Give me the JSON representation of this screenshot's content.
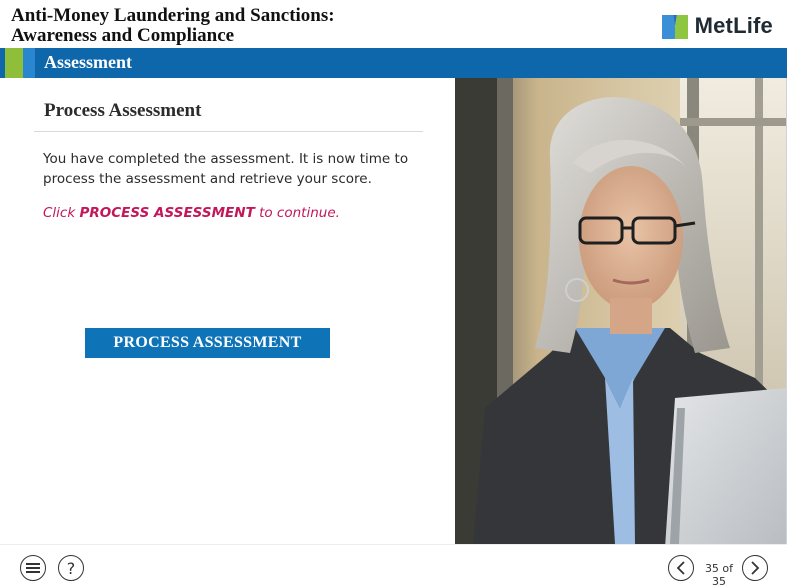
{
  "course": {
    "title_line1": "Anti-Money Laundering and Sanctions:",
    "title_line2": "Awareness and Compliance",
    "brand": "MetLife"
  },
  "section": {
    "title": "Assessment"
  },
  "panel": {
    "title": "Process Assessment",
    "body": "You have completed the assessment. It is now time to process the assessment and retrieve your score.",
    "instruction_prefix": "Click ",
    "instruction_emphasis": "PROCESS ASSESSMENT",
    "instruction_suffix": " to continue.",
    "button_label": "PROCESS ASSESSMENT"
  },
  "footer": {
    "menu_icon": "menu-icon",
    "help_label": "?",
    "page_counter": "35 of 35"
  },
  "colors": {
    "brand_blue": "#0f67ab",
    "accent_green": "#8fbf3a",
    "button_blue": "#0f73b8",
    "instruction_magenta": "#c2185b"
  }
}
